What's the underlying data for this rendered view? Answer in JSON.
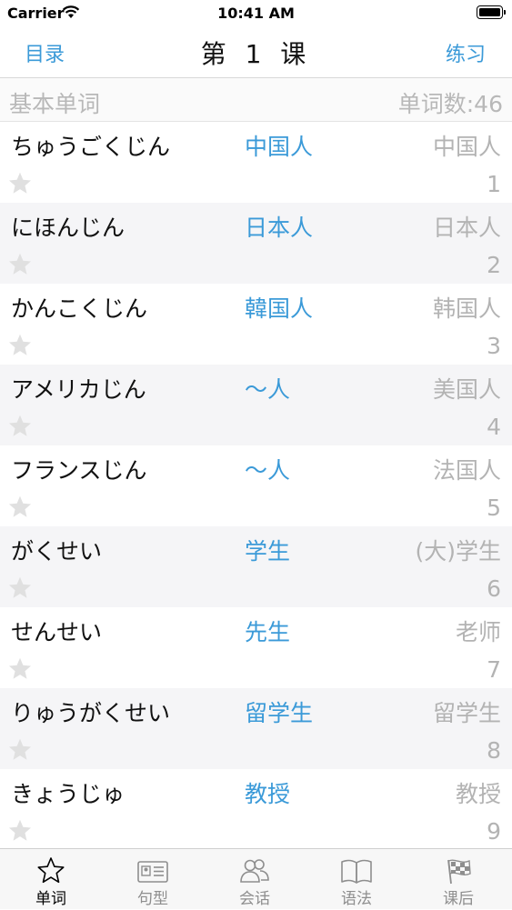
{
  "status": {
    "carrier": "Carrier",
    "time": "10:41 AM"
  },
  "nav": {
    "left": "目录",
    "title": "第 1 课",
    "right": "练习"
  },
  "section": {
    "title": "基本单词",
    "count": "单词数:46"
  },
  "words": [
    {
      "kana": "ちゅうごくじん",
      "kanji": "中国人",
      "meaning": "中国人",
      "num": "1"
    },
    {
      "kana": "にほんじん",
      "kanji": "日本人",
      "meaning": "日本人",
      "num": "2"
    },
    {
      "kana": "かんこくじん",
      "kanji": "韓国人",
      "meaning": "韩国人",
      "num": "3"
    },
    {
      "kana": "アメリカじん",
      "kanji": "～人",
      "meaning": "美国人",
      "num": "4"
    },
    {
      "kana": "フランスじん",
      "kanji": "～人",
      "meaning": "法国人",
      "num": "5"
    },
    {
      "kana": "がくせい",
      "kanji": "学生",
      "meaning": "(大)学生",
      "num": "6"
    },
    {
      "kana": "せんせい",
      "kanji": "先生",
      "meaning": "老师",
      "num": "7"
    },
    {
      "kana": "りゅうがくせい",
      "kanji": "留学生",
      "meaning": "留学生",
      "num": "8"
    },
    {
      "kana": "きょうじゅ",
      "kanji": "教授",
      "meaning": "教授",
      "num": "9"
    }
  ],
  "tabs": [
    {
      "label": "单词",
      "icon": "star-icon"
    },
    {
      "label": "句型",
      "icon": "id-card-icon"
    },
    {
      "label": "会话",
      "icon": "people-icon"
    },
    {
      "label": "语法",
      "icon": "book-icon"
    },
    {
      "label": "课后",
      "icon": "checkered-flag-icon"
    }
  ],
  "colors": {
    "accent": "#3b9ad8",
    "secondary_text": "#b3b3b3",
    "star": "#e0e0e0"
  }
}
